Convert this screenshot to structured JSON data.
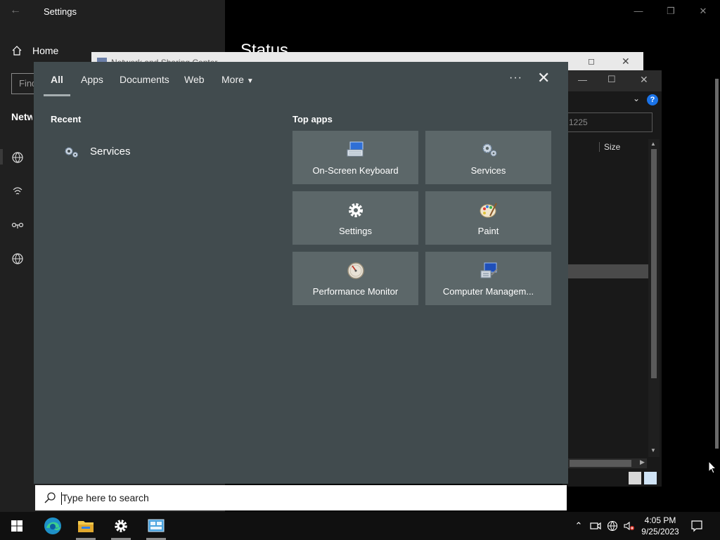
{
  "settings": {
    "title": "Settings",
    "back_icon": "back-arrow-icon",
    "home_label": "Home",
    "find_placeholder": "Find a setting",
    "section_heading": "Network & Internet",
    "page_title": "Status",
    "window_controls": [
      "minimize",
      "restore",
      "close"
    ]
  },
  "network_window": {
    "title": "Network and Sharing Center"
  },
  "explorer": {
    "search_value": "1225",
    "column_size": "Size",
    "help_label": "?"
  },
  "search_flyout": {
    "tabs": [
      {
        "label": "All",
        "active": true
      },
      {
        "label": "Apps"
      },
      {
        "label": "Documents"
      },
      {
        "label": "Web"
      },
      {
        "label": "More"
      }
    ],
    "more_options_label": "···",
    "recent_heading": "Recent",
    "recent_items": [
      {
        "label": "Services",
        "icon": "services-gears-icon"
      }
    ],
    "top_apps_heading": "Top apps",
    "top_apps": [
      {
        "label": "On-Screen Keyboard",
        "icon": "keyboard-icon"
      },
      {
        "label": "Services",
        "icon": "services-gears-icon"
      },
      {
        "label": "Settings",
        "icon": "gear-icon"
      },
      {
        "label": "Paint",
        "icon": "palette-icon"
      },
      {
        "label": "Performance Monitor",
        "icon": "gauge-icon"
      },
      {
        "label": "Computer Managem...",
        "icon": "computer-management-icon"
      }
    ],
    "search_placeholder": "Type here to search"
  },
  "taskbar": {
    "apps": [
      {
        "name": "start",
        "icon": "windows-logo-icon"
      },
      {
        "name": "edge",
        "icon": "edge-icon"
      },
      {
        "name": "file-explorer",
        "icon": "folder-icon",
        "running": true
      },
      {
        "name": "settings",
        "icon": "gear-icon",
        "running": true
      },
      {
        "name": "control-panel",
        "icon": "control-panel-icon",
        "running": true
      }
    ],
    "tray_icons": [
      "chevron-up-icon",
      "meet-now-icon",
      "network-icon",
      "volume-muted-icon"
    ],
    "time": "4:05 PM",
    "date": "9/25/2023"
  },
  "colors": {
    "flyout_bg": "#414b4e",
    "tile_bg": "#5c6769",
    "taskbar_bg": "#101010"
  }
}
